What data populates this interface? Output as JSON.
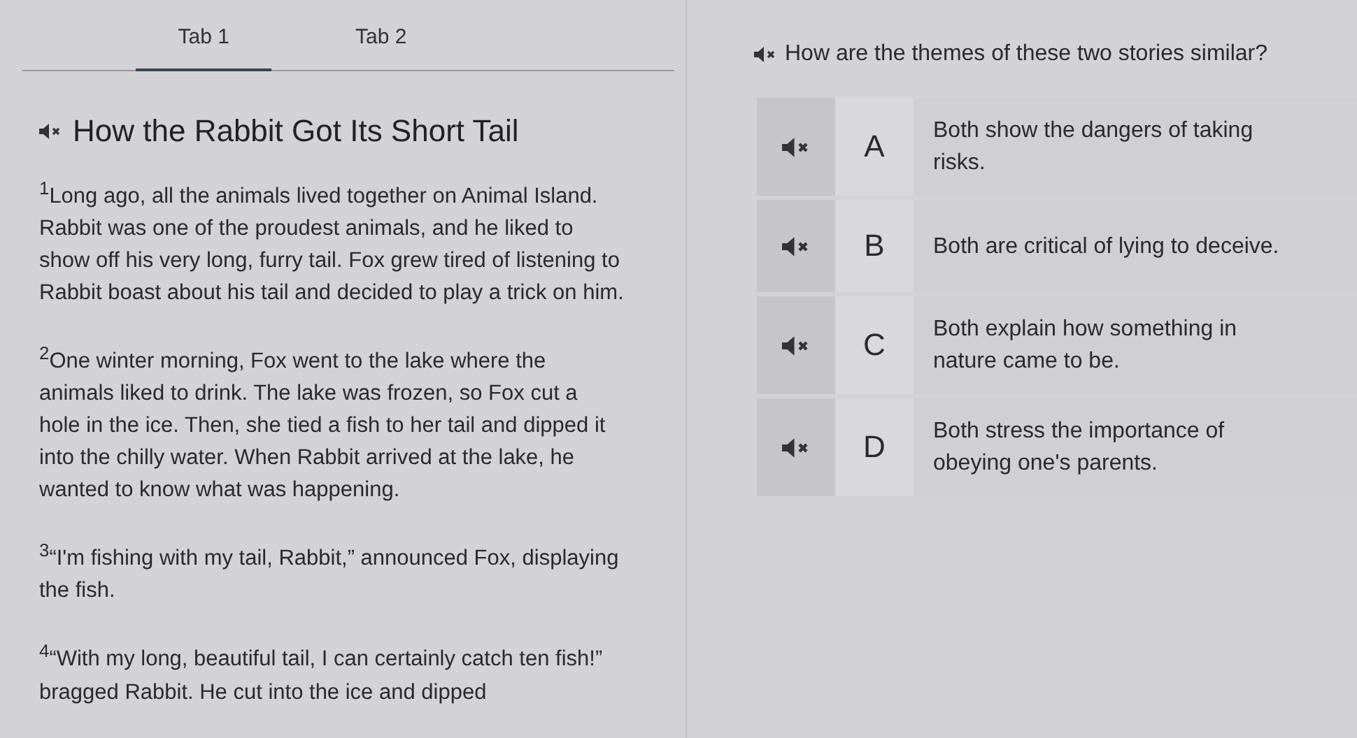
{
  "tabs": [
    {
      "label": "Tab 1",
      "selected": true
    },
    {
      "label": "Tab 2",
      "selected": false
    }
  ],
  "passage": {
    "title": "How the Rabbit Got Its Short Tail",
    "paragraphs": [
      "$^{1}$Long ago, all the animals lived together on Animal Island. Rabbit was one of the proudest animals, and he liked to show off his very long, furry tail. Fox grew tired of listening to Rabbit boast about his tail and decided to play a trick on him.",
      "$^{2}$One winter morning, Fox went to the lake where the animals liked to drink. The lake was frozen, so Fox cut a hole in the ice. Then, she tied a fish to her tail and dipped it into the chilly water. When Rabbit arrived at the lake, he wanted to know what was happening.",
      "$^{3}$“I'm fishing with my tail, Rabbit,” announced Fox, displaying the fish.",
      "$^{4}$“With my long, beautiful tail, I can certainly catch ten fish!” bragged Rabbit. He cut into the ice and dipped"
    ]
  },
  "question": {
    "text": "How are the themes of these two stories similar?",
    "options": [
      {
        "letter": "A",
        "text": "Both show the dangers of taking risks."
      },
      {
        "letter": "B",
        "text": "Both are critical of lying to deceive."
      },
      {
        "letter": "C",
        "text": "Both explain how something in nature came to be."
      },
      {
        "letter": "D",
        "text": "Both stress the importance of obeying one's parents."
      }
    ]
  }
}
